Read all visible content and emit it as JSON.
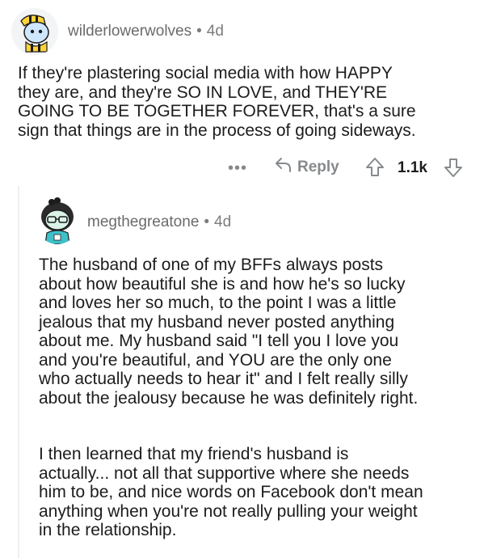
{
  "comment": {
    "author": "wilderlowerwolves",
    "separator": "•",
    "age": "4d",
    "body_lines": [
      "If they're plastering social media with how HAPPY",
      "they are, and they're SO IN LOVE, and THEY'RE",
      "GOING TO BE TOGETHER FOREVER, that's a sure",
      "sign that things are in the process of going sideways."
    ],
    "actions": {
      "more_label": "•••",
      "reply_label": "Reply",
      "score": "1.1k",
      "reply_icon": "reply-arrow-icon",
      "upvote_icon": "upvote-arrow-icon",
      "downvote_icon": "downvote-arrow-icon"
    }
  },
  "reply": {
    "author": "megthegreatone",
    "separator": "•",
    "age": "4d",
    "paragraph_1_lines": [
      "The husband of one of my BFFs always posts",
      "about how beautiful she is and how he's so lucky",
      "and loves her so much, to the point I was a little",
      "jealous that my husband never posted anything",
      "about me. My husband said \"I tell you I love you",
      "and you're beautiful, and YOU are the only one",
      "who actually needs to hear it\" and I felt really silly",
      "about the jealousy because he was definitely right."
    ],
    "paragraph_2_lines": [
      "I then learned that my friend's husband is",
      "actually... not all that supportive where she needs",
      "him to be, and nice words on Facebook don't mean",
      "anything when you're not really pulling your weight",
      "in the relationship."
    ]
  },
  "colors": {
    "text": "#1c1c1c",
    "meta": "#7c7c7c",
    "icon": "#878a8c",
    "thread_line": "#edeff1"
  }
}
